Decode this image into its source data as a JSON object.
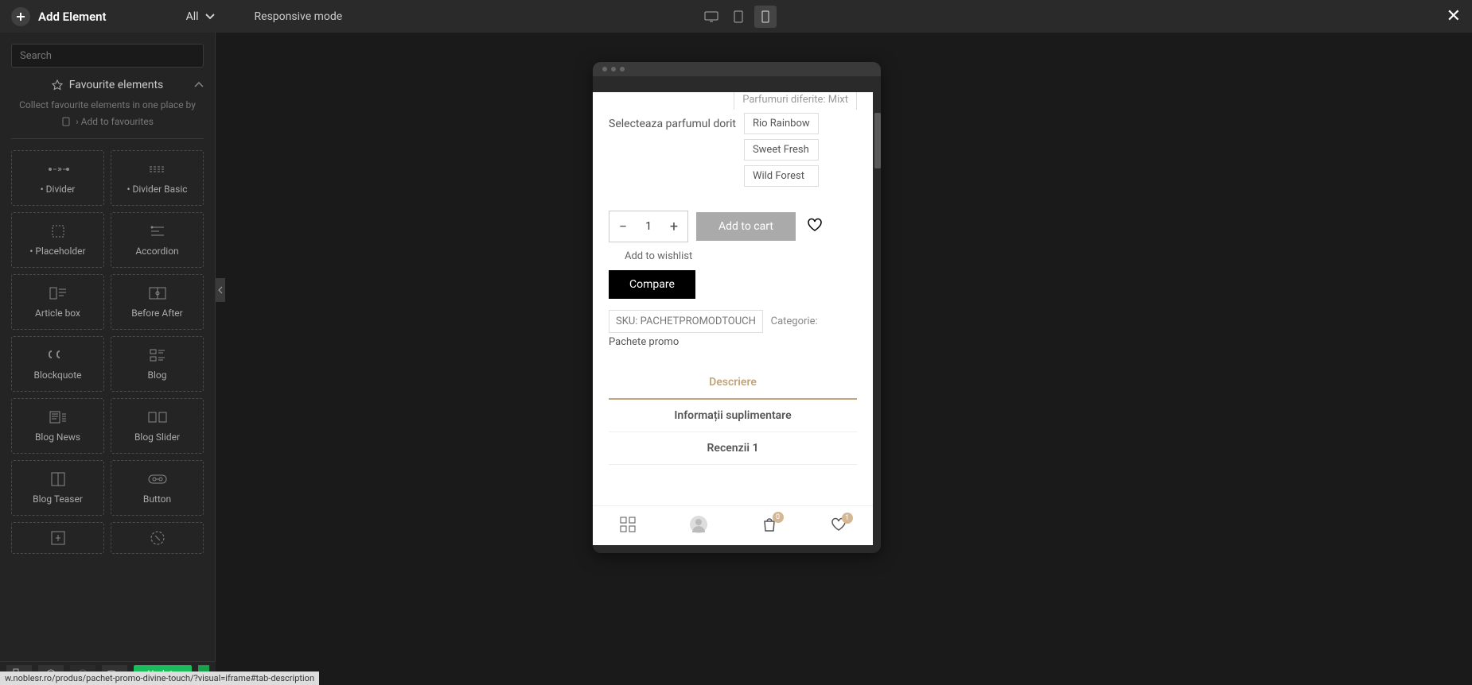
{
  "topbar": {
    "title": "Add Element",
    "filter": "All",
    "responsive": "Responsive mode"
  },
  "sidebar": {
    "search_placeholder": "Search",
    "fav_title": "Favourite elements",
    "fav_desc": "Collect favourite elements in one place by",
    "fav_add": "› Add to favourites",
    "elements": [
      {
        "label": "• Divider"
      },
      {
        "label": "• Divider Basic"
      },
      {
        "label": "• Placeholder"
      },
      {
        "label": "Accordion"
      },
      {
        "label": "Article box"
      },
      {
        "label": "Before After"
      },
      {
        "label": "Blockquote"
      },
      {
        "label": "Blog"
      },
      {
        "label": "Blog News"
      },
      {
        "label": "Blog Slider"
      },
      {
        "label": "Blog Teaser"
      },
      {
        "label": "Button"
      }
    ]
  },
  "bottombar": {
    "update": "Update"
  },
  "preview": {
    "partial_opt": "Parfumuri diferite: Mixt",
    "select_label": "Selecteaza parfumul dorit",
    "options": [
      "Rio Rainbow",
      "Sweet Fresh",
      "Wild Forest"
    ],
    "qty": "1",
    "add_cart": "Add to cart",
    "wishlist": "Add to wishlist",
    "compare": "Compare",
    "sku": "SKU: PACHETPROMODTOUCH",
    "cat_label": "Categorie: ",
    "cat_link": "Pachete promo",
    "tabs": [
      "Descriere",
      "Informații suplimentare",
      "Recenzii 1"
    ],
    "nav_badges": {
      "cart": "0",
      "wish": "1"
    }
  },
  "status_url": "w.noblesr.ro/produs/pachet-promo-divine-touch/?visual=iframe#tab-description"
}
